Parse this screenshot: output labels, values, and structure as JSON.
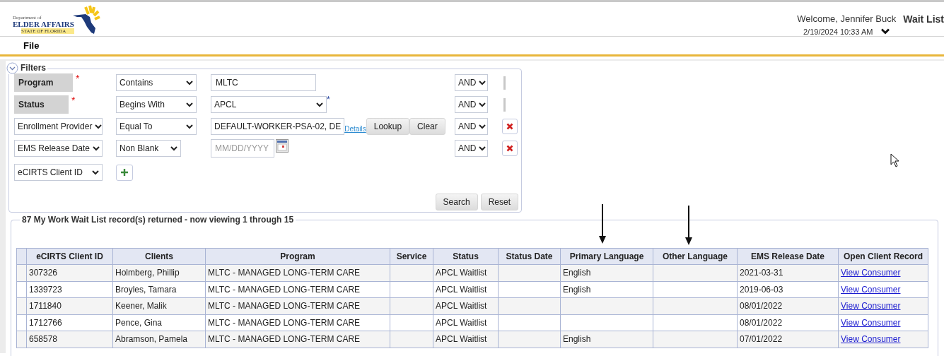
{
  "header": {
    "logo": {
      "small": "Department of",
      "name": "ELDER AFFAIRS",
      "state": "STATE OF FLORIDA"
    },
    "welcome": "Welcome, Jennifer Buck",
    "datetime": "2/19/2024 10:33 AM",
    "app_title": "Wait List"
  },
  "menu": [
    "File"
  ],
  "filters": {
    "legend": "Filters",
    "expanded": true,
    "rows": [
      {
        "field": {
          "kind": "label",
          "text": "Program",
          "required": true
        },
        "operator": "Contains",
        "value": {
          "kind": "text",
          "value": "MLTC"
        },
        "conjunction": "AND",
        "removable": false
      },
      {
        "field": {
          "kind": "label",
          "text": "Status",
          "required": true
        },
        "operator": "Begins With",
        "value": {
          "kind": "select",
          "value": "APCL",
          "mark": "*"
        },
        "conjunction": "AND",
        "removable": false
      },
      {
        "field": {
          "kind": "select",
          "text": "Enrollment Provider",
          "required": false
        },
        "operator": "Equal To",
        "value": {
          "kind": "lookup",
          "value": "DEFAULT-WORKER-PSA-02, DE",
          "link": "Details",
          "buttons": [
            "Lookup",
            "Clear"
          ]
        },
        "conjunction": "AND",
        "removable": true
      },
      {
        "field": {
          "kind": "select",
          "text": "EMS Release Date",
          "required": false
        },
        "operator": "Non Blank",
        "value": {
          "kind": "date",
          "placeholder": "MM/DD/YYYY"
        },
        "conjunction": "AND",
        "removable": true
      }
    ],
    "new_field": "eCIRTS Client ID",
    "buttons": [
      "Search",
      "Reset"
    ]
  },
  "results": {
    "legend": "87 My Work Wait List record(s) returned - now viewing 1 through 15",
    "columns": [
      "eCIRTS Client ID",
      "Clients",
      "Program",
      "Service",
      "Status",
      "Status Date",
      "Primary Language",
      "Other Language",
      "EMS Release Date",
      "Open Client Record"
    ],
    "rows": [
      {
        "cells": [
          "307326",
          "Holmberg, Phillip",
          "MLTC - MANAGED LONG-TERM CARE",
          "",
          "APCL Waitlist",
          "",
          "English",
          "",
          "2021-03-31"
        ],
        "link": "View Consumer"
      },
      {
        "cells": [
          "1339723",
          "Broyles, Tamara",
          "MLTC - MANAGED LONG-TERM CARE",
          "",
          "APCL Waitlist",
          "",
          "English",
          "",
          "2019-06-03"
        ],
        "link": "View Consumer"
      },
      {
        "cells": [
          "1711840",
          "Keener, Malik",
          "MLTC - MANAGED LONG-TERM CARE",
          "",
          "APCL Waitlist",
          "",
          "",
          "",
          "08/01/2022"
        ],
        "link": "View Consumer"
      },
      {
        "cells": [
          "1712766",
          "Pence, Gina",
          "MLTC - MANAGED LONG-TERM CARE",
          "",
          "APCL Waitlist",
          "",
          "",
          "",
          "08/01/2022"
        ],
        "link": "View Consumer"
      },
      {
        "cells": [
          "658578",
          "Abramson, Pamela",
          "MLTC - MANAGED LONG-TERM CARE",
          "",
          "APCL Waitlist",
          "",
          "English",
          "",
          "07/01/2022"
        ],
        "link": "View Consumer"
      }
    ]
  }
}
